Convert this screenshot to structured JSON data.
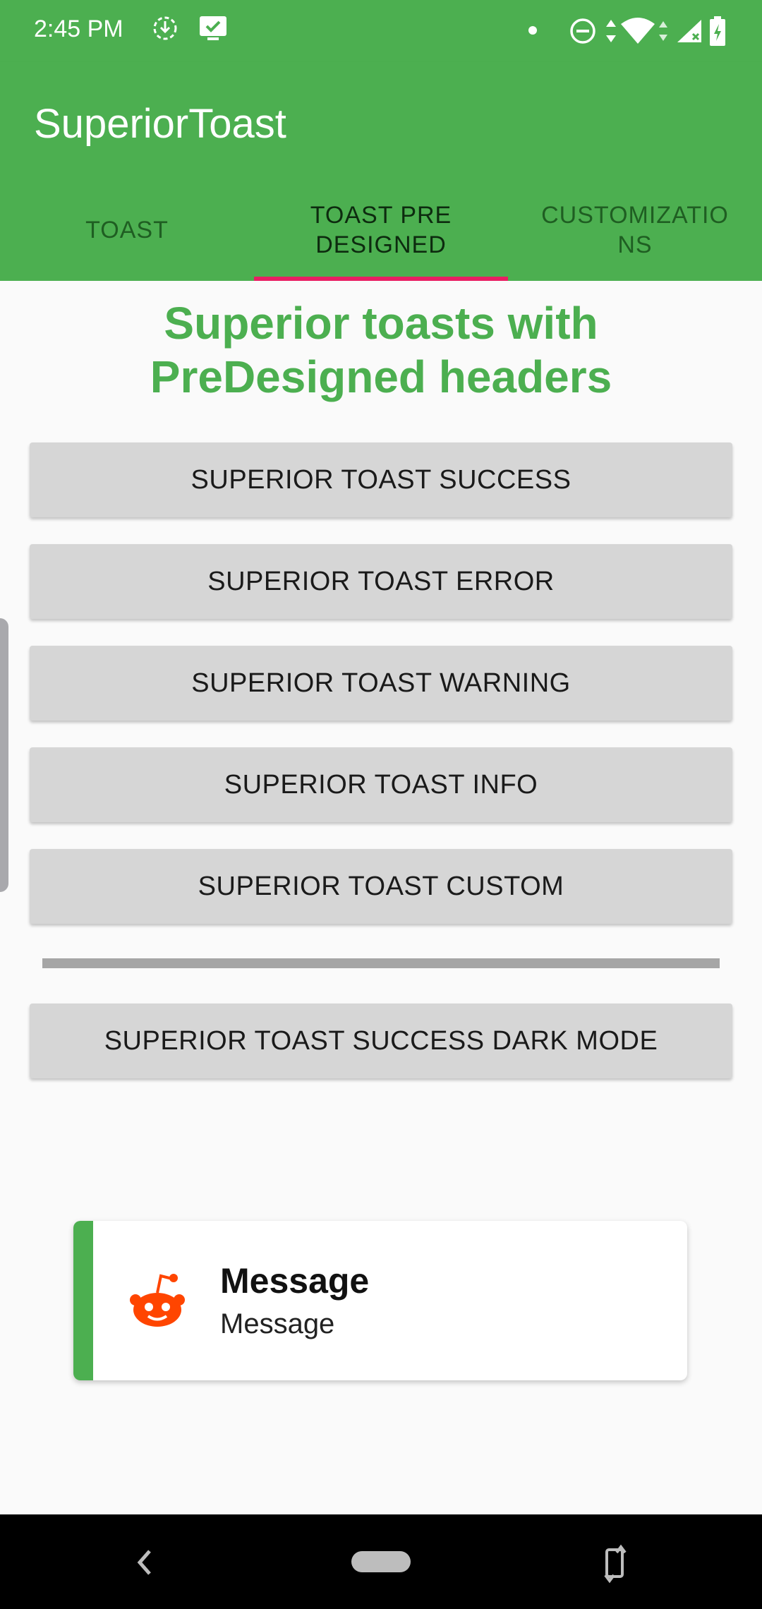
{
  "status_bar": {
    "time": "2:45 PM",
    "icons": [
      "download-icon",
      "screen-icon",
      "dot-icon",
      "dnd-icon",
      "data-arrows-icon",
      "wifi-icon",
      "signal-icon",
      "battery-icon"
    ]
  },
  "app_bar": {
    "title": "SuperiorToast"
  },
  "tabs": [
    {
      "label": "TOAST",
      "active": false
    },
    {
      "label": "TOAST PRE DESIGNED",
      "active": true
    },
    {
      "label": "CUSTOMIZATIONS",
      "active": false
    }
  ],
  "heading": "Superior toasts with PreDesigned headers",
  "buttons": {
    "success": "SUPERIOR TOAST SUCCESS",
    "error": "SUPERIOR TOAST ERROR",
    "warning": "SUPERIOR TOAST WARNING",
    "info": "SUPERIOR TOAST INFO",
    "custom": "SUPERIOR TOAST CUSTOM",
    "success_dark": "SUPERIOR TOAST SUCCESS DARK MODE"
  },
  "toast": {
    "title": "Message",
    "message": "Message",
    "icon": "reddit-icon"
  },
  "colors": {
    "primary": "#4caf50",
    "tab_indicator": "#e91e63",
    "button_bg": "#d6d6d6",
    "reddit_orange": "#ff4500"
  }
}
